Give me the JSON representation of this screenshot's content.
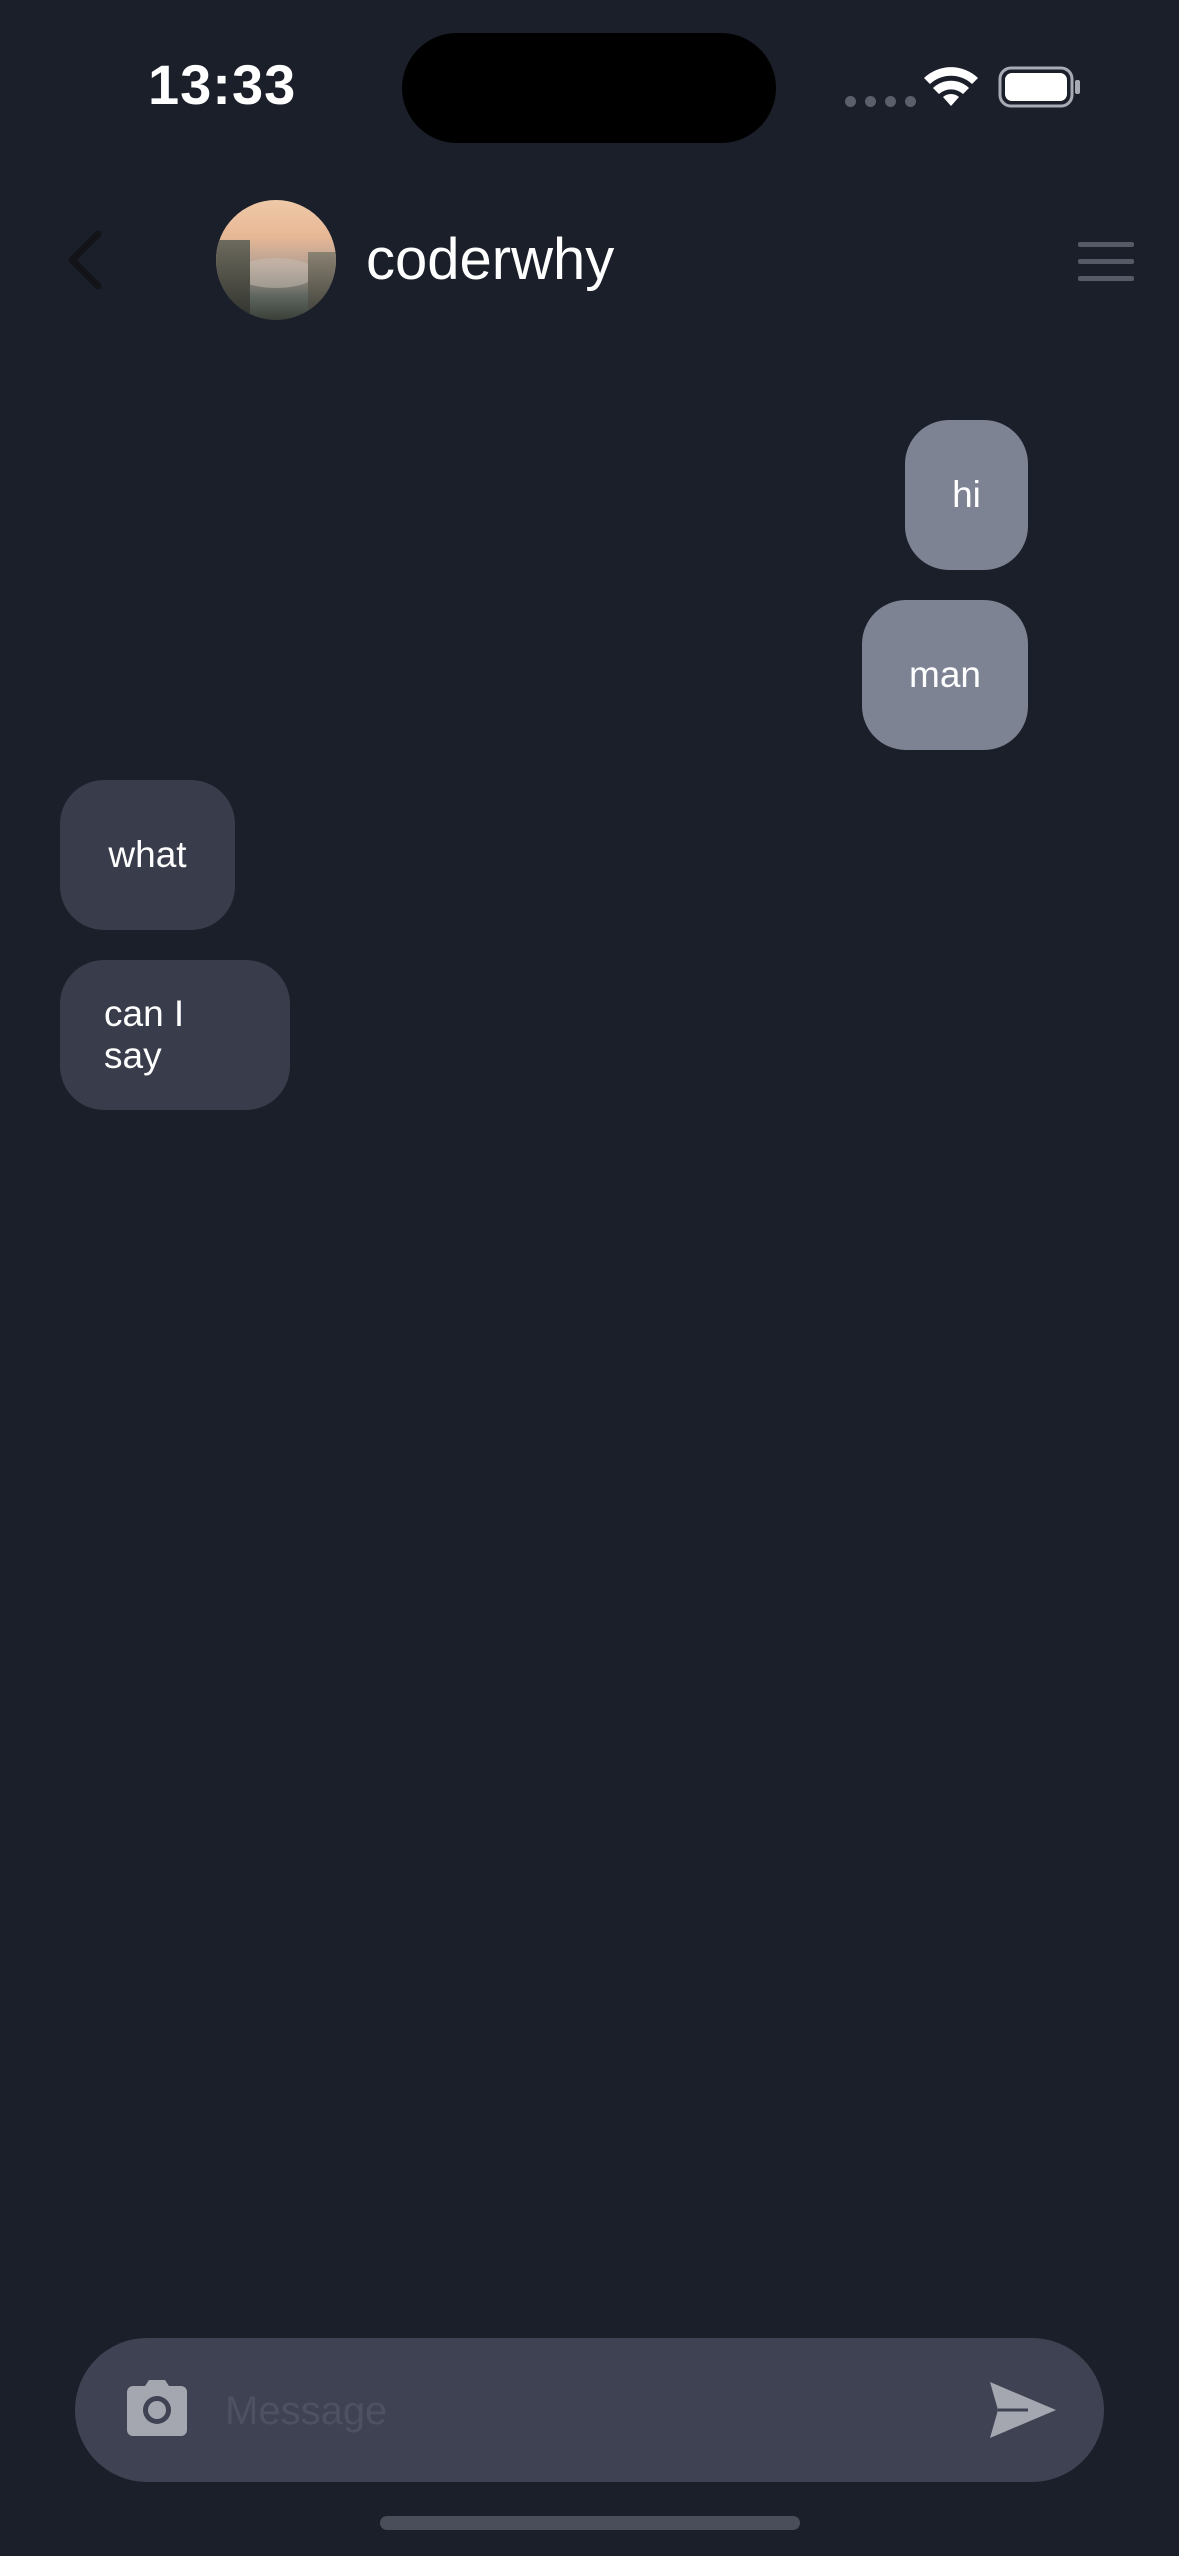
{
  "status_bar": {
    "time": "13:33"
  },
  "header": {
    "contact_name": "coderwhy",
    "back_icon": "chevron-left-icon",
    "menu_icon": "hamburger-menu-icon"
  },
  "messages": [
    {
      "text": "hi",
      "direction": "sent"
    },
    {
      "text": "man",
      "direction": "sent"
    },
    {
      "text": "what",
      "direction": "received"
    },
    {
      "text": "can I say",
      "direction": "received"
    }
  ],
  "composer": {
    "placeholder": "Message",
    "value": "",
    "camera_icon": "camera-icon",
    "send_icon": "send-icon"
  },
  "colors": {
    "background": "#1b1f2a",
    "sent_bubble": "#7e8394",
    "received_bubble": "#393d4b",
    "input_bar": "#3e4252"
  }
}
